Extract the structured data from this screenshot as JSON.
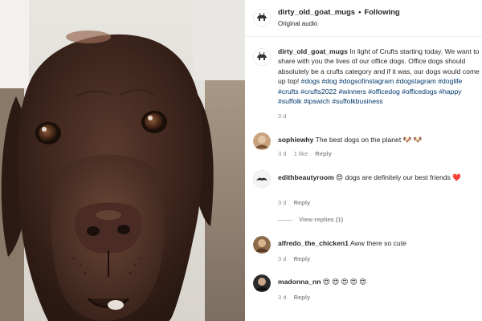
{
  "post": {
    "username": "dirty_old_goat_mugs",
    "follow_label": "Following",
    "separator": "•",
    "audio": "Original audio"
  },
  "caption": {
    "username": "dirty_old_goat_mugs",
    "text": "In light of Crufts starting today. We want to share with you the lives of our office dogs. Office dogs should absolutely be a crufts category and if it was, our dogs would come up top!",
    "hashtags": "#dogs #dog #dogsofinstagram #dogstagram #doglife #crufts #crufts2022 #winners #officedog #officedogs #happy #suffolk #ipswich #suffolkbusiness",
    "time": "3 d"
  },
  "comments": [
    {
      "username": "sophiewhy",
      "text": "The best dogs on the planet 🐶 🐶",
      "time": "3 d",
      "likes": "1 like",
      "reply": "Reply"
    },
    {
      "username": "edithbeautyroom",
      "text": "😍 dogs are definitely our best friends ❤️",
      "heart": "❤️",
      "time": "3 d",
      "reply": "Reply",
      "view_replies": "View replies (1)"
    },
    {
      "username": "alfredo_the_chicken1",
      "text": "Aww there so cute",
      "time": "3 d",
      "reply": "Reply"
    },
    {
      "username": "madonna_nn",
      "text": "😍 😍 😍 😍 😍",
      "time": "3 d",
      "reply": "Reply"
    }
  ],
  "icons": {
    "post_avatar": "goat-logo-avatar",
    "comment_like": "heart-outline-icon"
  },
  "colors": {
    "hashtag": "#00376b",
    "muted": "#8e8e8e",
    "text": "#262626"
  }
}
